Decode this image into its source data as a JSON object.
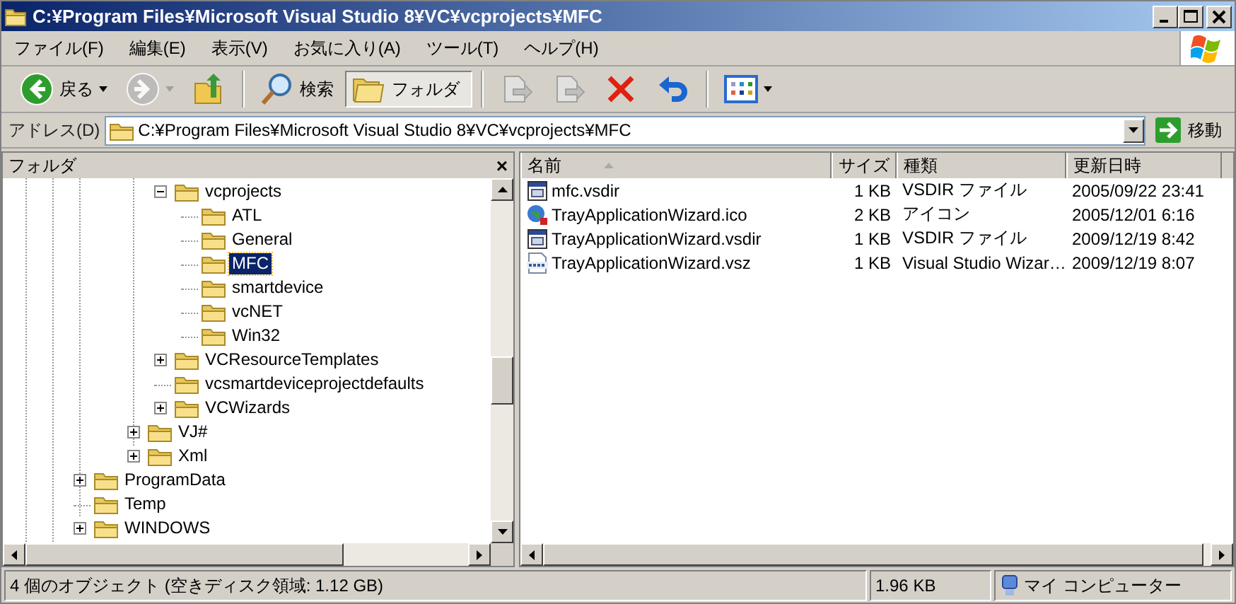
{
  "window": {
    "title": "C:¥Program Files¥Microsoft Visual Studio 8¥VC¥vcprojects¥MFC"
  },
  "menu": [
    "ファイル(F)",
    "編集(E)",
    "表示(V)",
    "お気に入り(A)",
    "ツール(T)",
    "ヘルプ(H)"
  ],
  "toolbar": [
    {
      "kind": "back",
      "label": "戻る",
      "dropdown": true,
      "disabled": false,
      "selected": false
    },
    {
      "kind": "forward",
      "dropdown": true,
      "disabled": true,
      "selected": false
    },
    {
      "kind": "up",
      "dropdown": false,
      "disabled": false,
      "selected": false
    },
    {
      "kind": "search",
      "label": "検索",
      "dropdown": false,
      "disabled": false,
      "selected": false
    },
    {
      "kind": "folders",
      "label": "フォルダ",
      "dropdown": false,
      "disabled": false,
      "selected": true
    },
    {
      "kind": "move",
      "dropdown": false,
      "disabled": true,
      "selected": false
    },
    {
      "kind": "copy",
      "dropdown": false,
      "disabled": true,
      "selected": false
    },
    {
      "kind": "delete",
      "dropdown": false,
      "disabled": false,
      "selected": false
    },
    {
      "kind": "undo",
      "dropdown": false,
      "disabled": false,
      "selected": false
    },
    {
      "kind": "views",
      "dropdown": true,
      "disabled": false,
      "selected": false
    }
  ],
  "address": {
    "label": "アドレス(D)",
    "value": "C:¥Program Files¥Microsoft Visual Studio 8¥VC¥vcprojects¥MFC",
    "go": "移動"
  },
  "folder_pane": {
    "title": "フォルダ",
    "close": "×"
  },
  "tree": [
    {
      "children": [
        {
          "children": [
            {
              "children": [
                {
                  "label": "vcprojects",
                  "expanded": true,
                  "selected": false,
                  "children": [
                    {
                      "label": "ATL",
                      "selected": false
                    },
                    {
                      "label": "General",
                      "selected": false
                    },
                    {
                      "label": "MFC",
                      "selected": true
                    },
                    {
                      "label": "smartdevice",
                      "selected": false
                    },
                    {
                      "label": "vcNET",
                      "selected": false
                    },
                    {
                      "label": "Win32",
                      "selected": false
                    }
                  ]
                },
                {
                  "label": "VCResourceTemplates",
                  "expanded": false,
                  "selected": false
                },
                {
                  "label": "vcsmartdeviceprojectdefaults",
                  "selected": false
                },
                {
                  "label": "VCWizards",
                  "expanded": false,
                  "selected": false
                }
              ]
            },
            {
              "label": "VJ#",
              "expanded": false,
              "selected": false
            },
            {
              "label": "Xml",
              "expanded": false,
              "selected": false
            }
          ]
        }
      ]
    },
    {
      "label": "ProgramData",
      "expanded": false,
      "selected": false
    },
    {
      "label": "Temp",
      "selected": false
    },
    {
      "label": "WINDOWS",
      "expanded": false,
      "selected": false
    }
  ],
  "table": {
    "columns": [
      "名前",
      "サイズ",
      "種類",
      "更新日時"
    ],
    "rows": [
      {
        "kind": "vsdir",
        "name": "mfc.vsdir",
        "size": "1 KB",
        "type": "VSDIR ファイル",
        "modified": "2005/09/22 23:41"
      },
      {
        "kind": "ico",
        "name": "TrayApplicationWizard.ico",
        "size": "2 KB",
        "type": "アイコン",
        "modified": "2005/12/01 6:16"
      },
      {
        "kind": "vsdir",
        "name": "TrayApplicationWizard.vsdir",
        "size": "1 KB",
        "type": "VSDIR ファイル",
        "modified": "2009/12/19 8:42"
      },
      {
        "kind": "vsz",
        "name": "TrayApplicationWizard.vsz",
        "size": "1 KB",
        "type": "Visual Studio Wizar…",
        "modified": "2009/12/19 8:07"
      }
    ]
  },
  "status_bar": [
    "4 個のオブジェクト (空きディスク領域: 1.12 GB)",
    "1.96 KB",
    "マイ コンピューター"
  ]
}
